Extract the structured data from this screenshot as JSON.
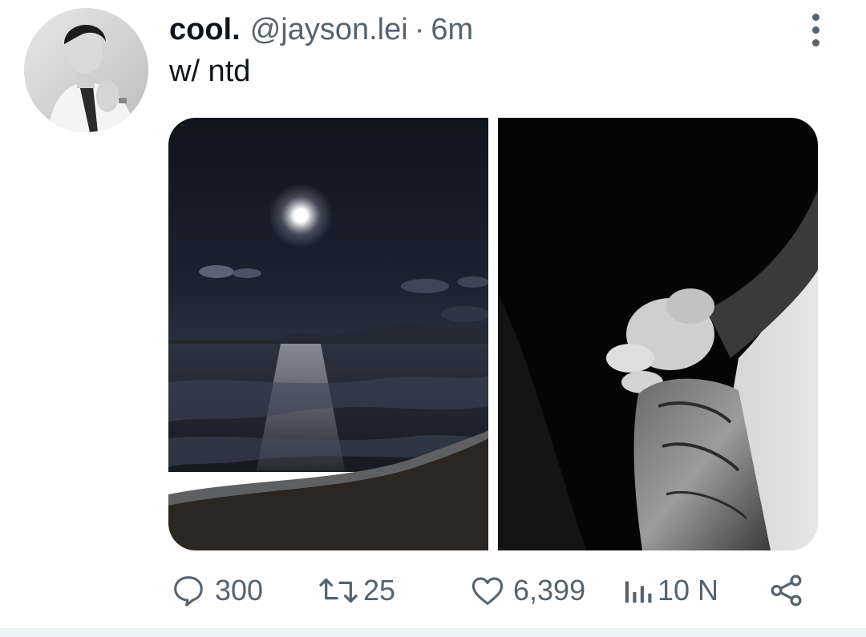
{
  "tweet": {
    "display_name": "cool.",
    "handle": "@jayson.lei",
    "separator": "·",
    "time": "6m",
    "text": "w/ ntd"
  },
  "media": {
    "photos": [
      {
        "subject": "moonlit-sea-photo"
      },
      {
        "subject": "holding-hands-photo"
      }
    ]
  },
  "actions": {
    "replies": "300",
    "retweets": "25",
    "likes": "6,399",
    "views": "10 N"
  },
  "icons": {
    "reply": "speech-bubble-icon",
    "retweet": "retweet-arrows-icon",
    "like": "heart-icon",
    "views": "bar-chart-icon",
    "share": "share-icon",
    "more": "vertical-dots-icon"
  },
  "colors": {
    "text_primary": "#0f1419",
    "text_secondary": "#536471",
    "divider": "#eff3f4"
  }
}
